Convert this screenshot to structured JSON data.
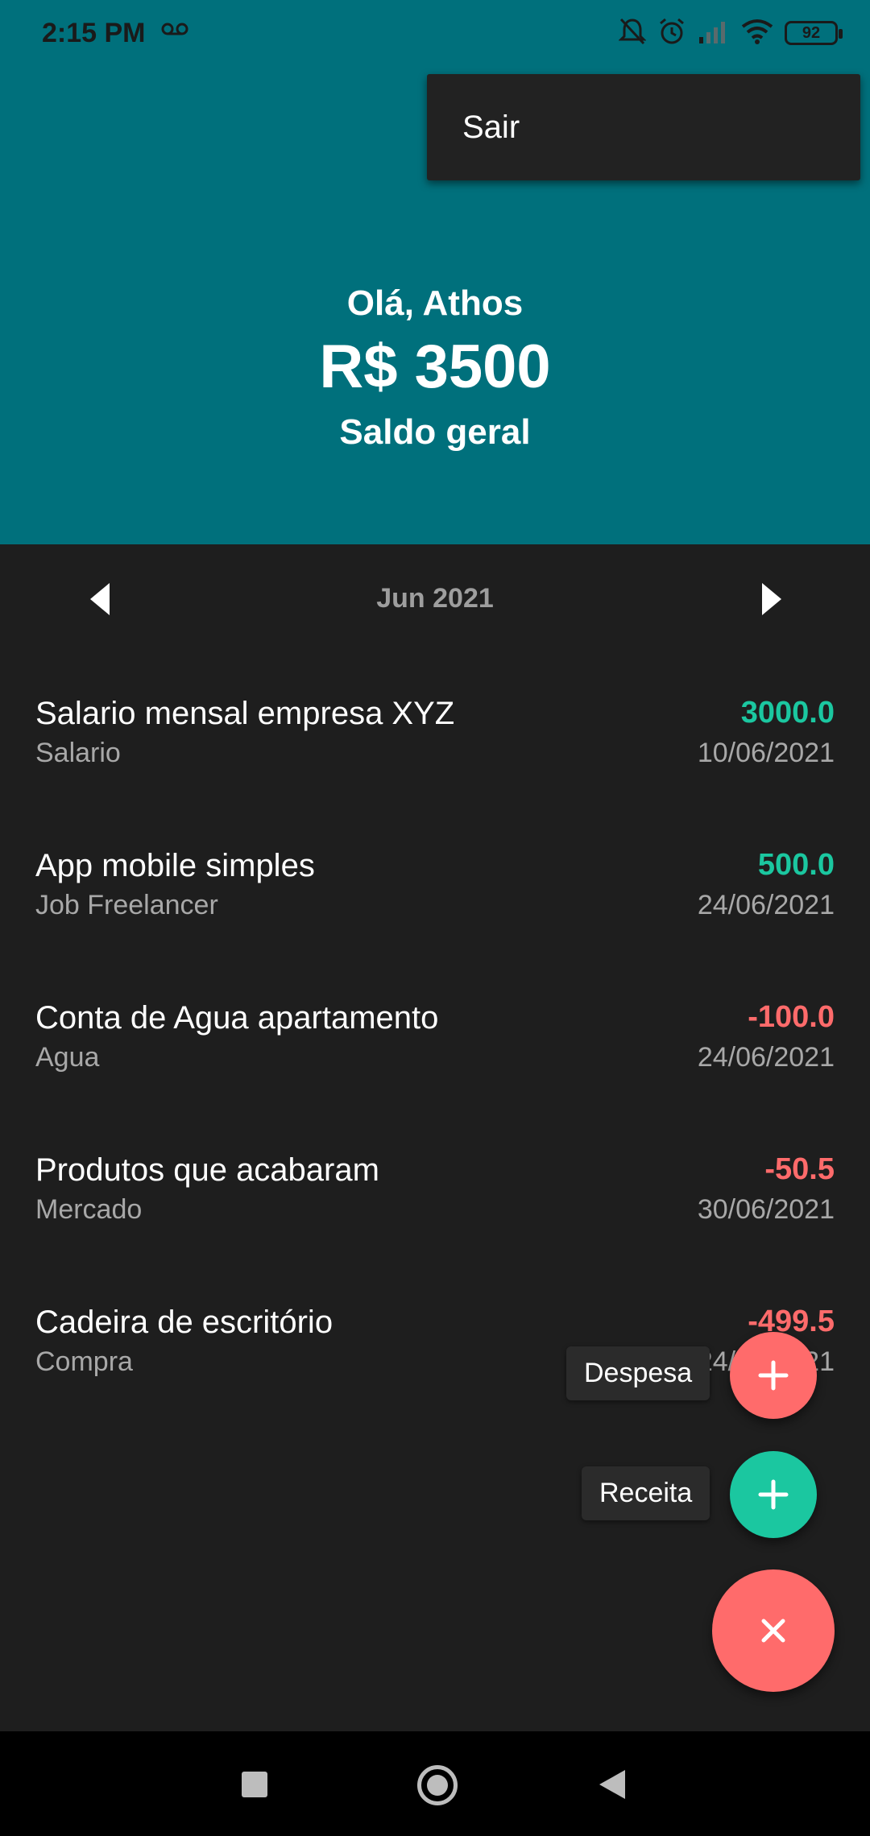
{
  "status_bar": {
    "time": "2:15 PM",
    "battery": "92"
  },
  "menu": {
    "items": [
      {
        "label": "Sair"
      }
    ]
  },
  "header": {
    "greeting": "Olá, Athos",
    "balance": "R$ 3500",
    "balance_label": "Saldo geral"
  },
  "month_selector": {
    "label": "Jun 2021"
  },
  "transactions": [
    {
      "title": "Salario mensal empresa XYZ",
      "category": "Salario",
      "amount": "3000.0",
      "date": "10/06/2021",
      "type": "income"
    },
    {
      "title": "App mobile simples",
      "category": "Job Freelancer",
      "amount": "500.0",
      "date": "24/06/2021",
      "type": "income"
    },
    {
      "title": "Conta de Agua apartamento",
      "category": "Agua",
      "amount": "-100.0",
      "date": "24/06/2021",
      "type": "expense"
    },
    {
      "title": "Produtos que acabaram",
      "category": "Mercado",
      "amount": "-50.5",
      "date": "30/06/2021",
      "type": "expense"
    },
    {
      "title": "Cadeira de escritório",
      "category": "Compra",
      "amount": "-499.5",
      "date": "24/06/2021",
      "type": "expense"
    }
  ],
  "fab": {
    "expense_label": "Despesa",
    "income_label": "Receita"
  },
  "colors": {
    "primary": "#00707c",
    "income": "#1bc7a0",
    "expense": "#ff6b6b",
    "background": "#1e1e1e"
  }
}
